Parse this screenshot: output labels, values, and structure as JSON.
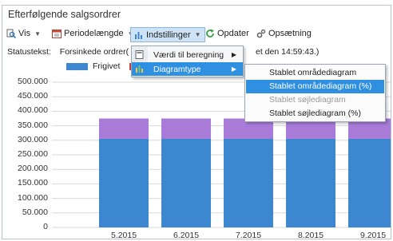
{
  "window": {
    "title": "Efterfølgende salgsordrer"
  },
  "toolbar": {
    "view_label": "Vis",
    "period_label": "Periodelængde",
    "settings_label": "Indstillinger",
    "refresh_label": "Opdater",
    "setup_label": "Opsætning"
  },
  "status": {
    "label": "Statustekst:",
    "text": "Forsinkede ordrer(",
    "tail": "et den 14:59:43.)"
  },
  "legend": {
    "items": [
      {
        "name": "Frigivet",
        "color": "#3d87d0"
      },
      {
        "name": "",
        "color": "#c94040"
      }
    ]
  },
  "menu": {
    "items": [
      {
        "label": "Værdi til beregning"
      },
      {
        "label": "Diagramtype"
      }
    ],
    "submenu": [
      {
        "label": "Stablet områdediagram",
        "state": "normal"
      },
      {
        "label": "Stablet områdediagram (%)",
        "state": "highlighted"
      },
      {
        "label": "Stablet søjlediagram",
        "state": "disabled"
      },
      {
        "label": "Stablet søjlediagram (%)",
        "state": "normal"
      }
    ]
  },
  "chart_data": {
    "type": "bar",
    "stacked": true,
    "categories": [
      "5.2015",
      "6.2015",
      "7.2015",
      "8.2015",
      "9.2015"
    ],
    "series": [
      {
        "name": "Frigivet",
        "color": "#3d87d0",
        "values": [
          305000,
          305000,
          305000,
          305000,
          305000
        ]
      },
      {
        "color": "#a87bd8",
        "values": [
          70000,
          70000,
          70000,
          70000,
          70000
        ]
      }
    ],
    "ylim": [
      0,
      500000
    ],
    "yticks": [
      "0",
      "50.000",
      "100.000",
      "150.000",
      "200.000",
      "250.000",
      "300.000",
      "350.000",
      "400.000",
      "450.000",
      "500.000"
    ]
  }
}
